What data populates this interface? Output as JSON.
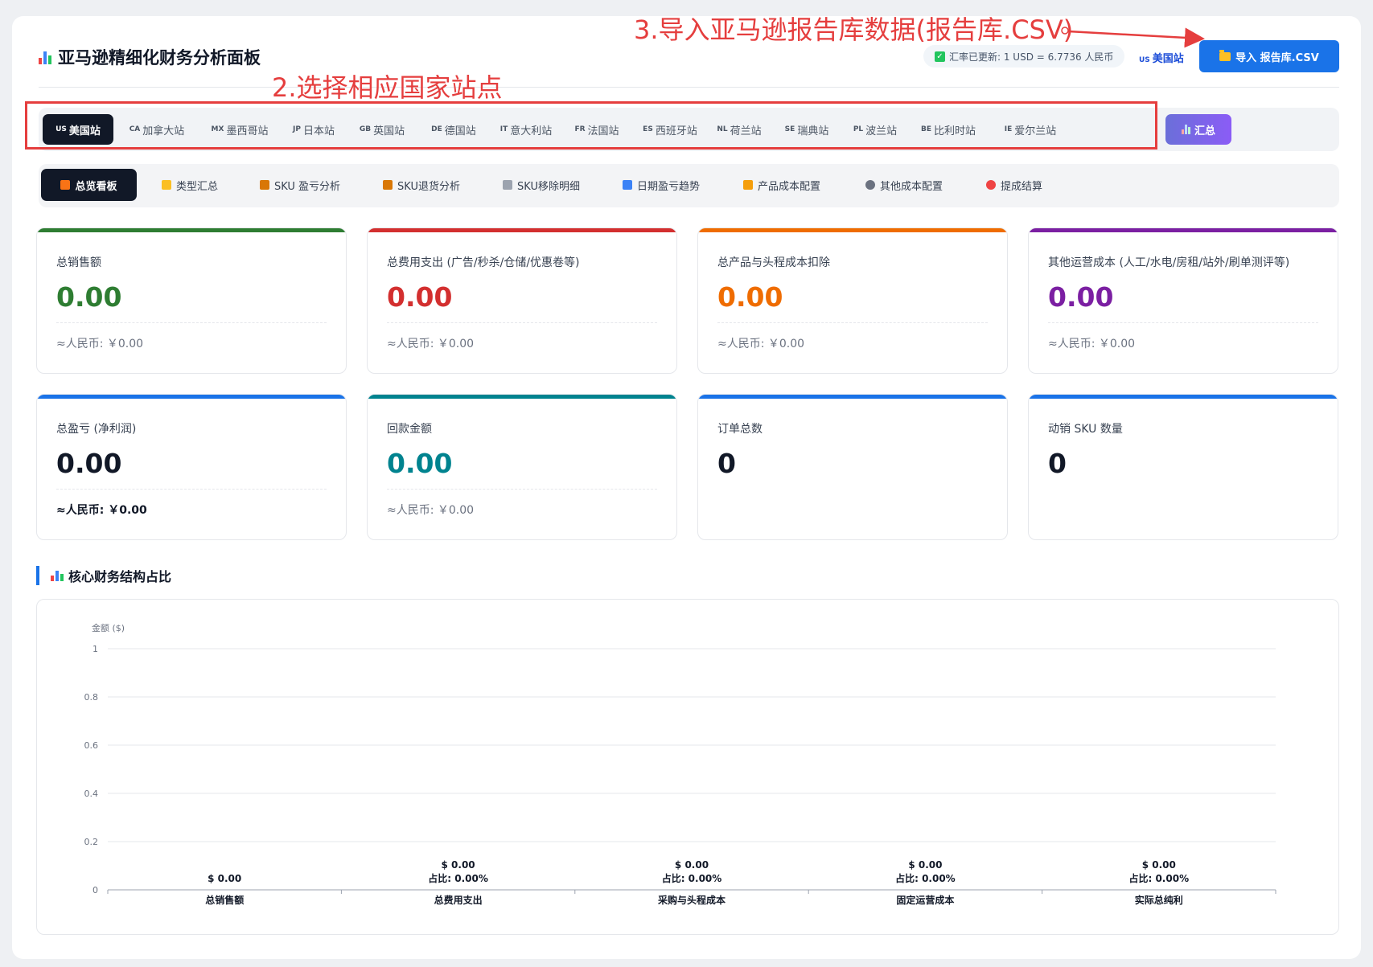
{
  "header": {
    "title": "亚马逊精细化财务分析面板",
    "rate_text": "汇率已更新: 1 USD = 6.7736 人民币",
    "current_site_code": "US",
    "current_site_name": "美国站",
    "import_label": "导入 报告库.CSV"
  },
  "annotations": {
    "step2": "2.选择相应国家站点",
    "step3": "3.导入亚马逊报告库数据(报告库.CSV)",
    "color": "#e53e3e"
  },
  "sites": [
    {
      "code": "US",
      "name": "美国站"
    },
    {
      "code": "CA",
      "name": "加拿大站"
    },
    {
      "code": "MX",
      "name": "墨西哥站"
    },
    {
      "code": "JP",
      "name": "日本站"
    },
    {
      "code": "GB",
      "name": "英国站"
    },
    {
      "code": "DE",
      "name": "德国站"
    },
    {
      "code": "IT",
      "name": "意大利站"
    },
    {
      "code": "FR",
      "name": "法国站"
    },
    {
      "code": "ES",
      "name": "西班牙站"
    },
    {
      "code": "NL",
      "name": "荷兰站"
    },
    {
      "code": "SE",
      "name": "瑞典站"
    },
    {
      "code": "PL",
      "name": "波兰站"
    },
    {
      "code": "BE",
      "name": "比利时站"
    },
    {
      "code": "IE",
      "name": "爱尔兰站"
    }
  ],
  "summary_label": "汇总",
  "nav_tabs": [
    {
      "label": "总览看板",
      "icon": "home-icon"
    },
    {
      "label": "类型汇总",
      "icon": "folder-icon"
    },
    {
      "label": "SKU 盈亏分析",
      "icon": "box-icon"
    },
    {
      "label": "SKU退货分析",
      "icon": "box-icon"
    },
    {
      "label": "SKU移除明细",
      "icon": "trash-icon"
    },
    {
      "label": "日期盈亏趋势",
      "icon": "calendar-icon"
    },
    {
      "label": "产品成本配置",
      "icon": "money-bag-icon"
    },
    {
      "label": "其他成本配置",
      "icon": "gear-icon"
    },
    {
      "label": "提成结算",
      "icon": "medal-icon"
    }
  ],
  "cards": [
    {
      "title": "总销售额",
      "value": "0.00",
      "sub": "≈人民币: ￥0.00",
      "color": "#2e7d32"
    },
    {
      "title": "总费用支出 (广告/秒杀/仓储/优惠卷等)",
      "value": "0.00",
      "sub": "≈人民币: ￥0.00",
      "color": "#d32f2f"
    },
    {
      "title": "总产品与头程成本扣除",
      "value": "0.00",
      "sub": "≈人民币: ￥0.00",
      "color": "#ef6c00"
    },
    {
      "title": "其他运营成本 (人工/水电/房租/站外/刷单测评等)",
      "value": "0.00",
      "sub": "≈人民币: ￥0.00",
      "color": "#7b1fa2"
    },
    {
      "title": "总盈亏 (净利润)",
      "value": "0.00",
      "sub": "≈人民币: ￥0.00",
      "color": "#111827"
    },
    {
      "title": "回款金额",
      "value": "0.00",
      "sub": "≈人民币: ￥0.00",
      "color": "#00838f"
    },
    {
      "title": "订单总数",
      "value": "0",
      "sub": "",
      "color": "#111827"
    },
    {
      "title": "动销 SKU 数量",
      "value": "0",
      "sub": "",
      "color": "#111827"
    }
  ],
  "section": {
    "title": "核心财务结构占比"
  },
  "chart_data": {
    "type": "bar",
    "ylabel": "金额 ($)",
    "ylim": [
      0,
      1
    ],
    "yticks": [
      "0",
      "0.2",
      "0.4",
      "0.6",
      "0.8",
      "1"
    ],
    "categories": [
      "总销售额",
      "总费用支出",
      "采购与头程成本",
      "固定运营成本",
      "实际总纯利"
    ],
    "values": [
      0,
      0,
      0,
      0,
      0
    ],
    "data_labels": [
      [
        "$ 0.00"
      ],
      [
        "$ 0.00",
        "占比: 0.00%"
      ],
      [
        "$ 0.00",
        "占比: 0.00%"
      ],
      [
        "$ 0.00",
        "占比: 0.00%"
      ],
      [
        "$ 0.00",
        "占比: 0.00%"
      ]
    ],
    "grid": true,
    "legend": "none"
  }
}
